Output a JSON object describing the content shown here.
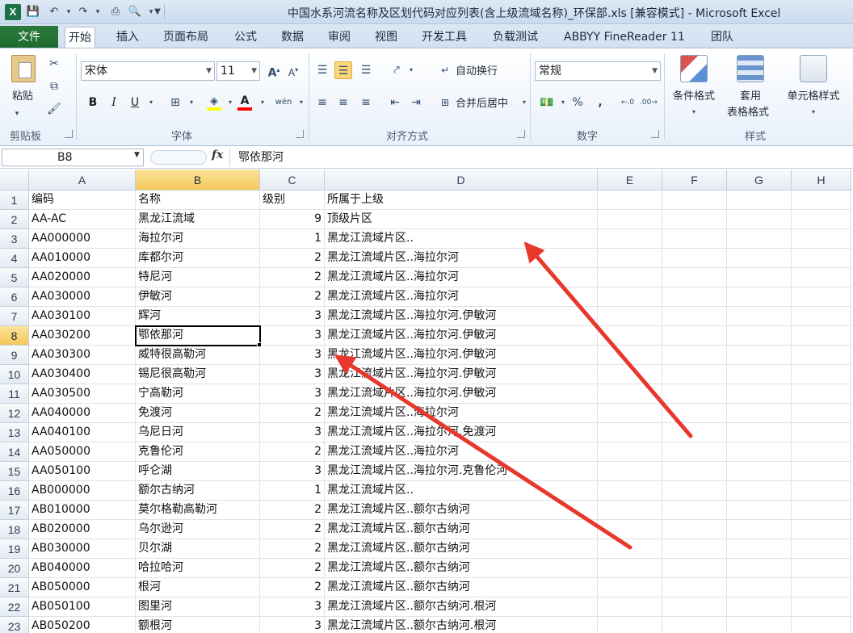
{
  "window": {
    "title": "中国水系河流名称及区划代码对应列表(含上级流域名称)_环保部.xls  [兼容模式] - Microsoft Excel",
    "app_icon": "X",
    "qat_icons": [
      "save-icon",
      "undo-icon",
      "redo-icon",
      "print-icon",
      "print-preview-icon",
      "customize-qat-icon"
    ]
  },
  "tabs": {
    "file": "文件",
    "items": [
      "开始",
      "插入",
      "页面布局",
      "公式",
      "数据",
      "审阅",
      "视图",
      "开发工具",
      "负载测试",
      "ABBYY FineReader 11",
      "团队"
    ],
    "active_index": 0
  },
  "ribbon": {
    "clipboard": {
      "label": "剪贴板",
      "paste": "粘贴"
    },
    "font": {
      "label": "字体",
      "name": "宋体",
      "size": "11",
      "bold": "B",
      "italic": "I",
      "underline": "U",
      "grow": "A",
      "shrink": "A",
      "phonetic": "wén"
    },
    "alignment": {
      "label": "对齐方式",
      "wrap": "自动换行",
      "merge": "合并后居中"
    },
    "number": {
      "label": "数字",
      "format": "常规",
      "percent": "%",
      "comma": ","
    },
    "styles": {
      "label": "样式",
      "conditional": "条件格式",
      "table_line1": "套用",
      "table_line2": "表格格式",
      "cell_styles": "单元格样式"
    },
    "accent_colors": {
      "highlight": "#ffff00",
      "font_color": "#ff0000",
      "file_tab": "#1d6a2d",
      "selection_header": "#f5c85a"
    }
  },
  "formula_bar": {
    "name_box": "B8",
    "fx": "fx",
    "content": "鄂依那河"
  },
  "sheet": {
    "columns": [
      "A",
      "B",
      "C",
      "D",
      "E",
      "F",
      "G",
      "H"
    ],
    "selected_column": "B",
    "selected_row": 8,
    "rows": [
      {
        "n": 1,
        "a": "编码",
        "b": "名称",
        "c": "级别",
        "d": "所属于上级"
      },
      {
        "n": 2,
        "a": "AA-AC",
        "b": "黑龙江流域",
        "c": "9",
        "d": "顶级片区"
      },
      {
        "n": 3,
        "a": "AA000000",
        "b": "海拉尔河",
        "c": "1",
        "d": "黑龙江流域片区.."
      },
      {
        "n": 4,
        "a": "AA010000",
        "b": "库都尔河",
        "c": "2",
        "d": "黑龙江流域片区..海拉尔河"
      },
      {
        "n": 5,
        "a": "AA020000",
        "b": "特尼河",
        "c": "2",
        "d": "黑龙江流域片区..海拉尔河"
      },
      {
        "n": 6,
        "a": "AA030000",
        "b": "伊敏河",
        "c": "2",
        "d": "黑龙江流域片区..海拉尔河"
      },
      {
        "n": 7,
        "a": "AA030100",
        "b": "辉河",
        "c": "3",
        "d": "黑龙江流域片区..海拉尔河.伊敏河"
      },
      {
        "n": 8,
        "a": "AA030200",
        "b": "鄂依那河",
        "c": "3",
        "d": "黑龙江流域片区..海拉尔河.伊敏河"
      },
      {
        "n": 9,
        "a": "AA030300",
        "b": "威特很高勒河",
        "c": "3",
        "d": "黑龙江流域片区..海拉尔河.伊敏河"
      },
      {
        "n": 10,
        "a": "AA030400",
        "b": "锡尼很高勒河",
        "c": "3",
        "d": "黑龙江流域片区..海拉尔河.伊敏河"
      },
      {
        "n": 11,
        "a": "AA030500",
        "b": "宁高勒河",
        "c": "3",
        "d": "黑龙江流域片区..海拉尔河.伊敏河"
      },
      {
        "n": 12,
        "a": "AA040000",
        "b": "免渡河",
        "c": "2",
        "d": "黑龙江流域片区..海拉尔河"
      },
      {
        "n": 13,
        "a": "AA040100",
        "b": "乌尼日河",
        "c": "3",
        "d": "黑龙江流域片区..海拉尔河.免渡河"
      },
      {
        "n": 14,
        "a": "AA050000",
        "b": "克鲁伦河",
        "c": "2",
        "d": "黑龙江流域片区..海拉尔河"
      },
      {
        "n": 15,
        "a": "AA050100",
        "b": "呼仑湖",
        "c": "3",
        "d": "黑龙江流域片区..海拉尔河.克鲁伦河"
      },
      {
        "n": 16,
        "a": "AB000000",
        "b": "额尔古纳河",
        "c": "1",
        "d": "黑龙江流域片区.."
      },
      {
        "n": 17,
        "a": "AB010000",
        "b": "莫尔格勒高勒河",
        "c": "2",
        "d": "黑龙江流域片区..额尔古纳河"
      },
      {
        "n": 18,
        "a": "AB020000",
        "b": "乌尔逊河",
        "c": "2",
        "d": "黑龙江流域片区..额尔古纳河"
      },
      {
        "n": 19,
        "a": "AB030000",
        "b": "贝尔湖",
        "c": "2",
        "d": "黑龙江流域片区..额尔古纳河"
      },
      {
        "n": 20,
        "a": "AB040000",
        "b": "哈拉哈河",
        "c": "2",
        "d": "黑龙江流域片区..额尔古纳河"
      },
      {
        "n": 21,
        "a": "AB050000",
        "b": "根河",
        "c": "2",
        "d": "黑龙江流域片区..额尔古纳河"
      },
      {
        "n": 22,
        "a": "AB050100",
        "b": "图里河",
        "c": "3",
        "d": "黑龙江流域片区..额尔古纳河.根河"
      },
      {
        "n": 23,
        "a": "AB050200",
        "b": "额根河",
        "c": "3",
        "d": "黑龙江流域片区..额尔古纳河.根河"
      }
    ],
    "annotation_color": "#e8382c"
  }
}
